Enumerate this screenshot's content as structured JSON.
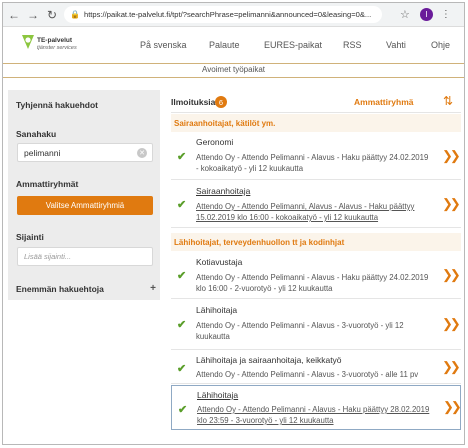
{
  "browser": {
    "back": "←",
    "forward": "→",
    "reload": "↻",
    "url": "https://paikat.te-palvelut.fi/tpt/?searchPhrase=pelimanni&announced=0&leasing=0&...",
    "avatar_letter": "I"
  },
  "header": {
    "logo_line1": "TE-palvelut",
    "logo_line2": "tjänster services",
    "nav": [
      "På svenska",
      "Palaute",
      "EURES-paikat",
      "RSS",
      "Vahti",
      "Ohje"
    ],
    "subtitle": "Avoimet työpaikat"
  },
  "sidebar": {
    "clear_label": "Tyhjennä hakuehdot",
    "keyword_label": "Sanahaku",
    "keyword_value": "pelimanni",
    "groups_label": "Ammattiryhmät",
    "groups_button": "Valitse Ammattiryhmiä",
    "location_label": "Sijainti",
    "location_placeholder": "Lisää sijainti...",
    "more_label": "Enemmän hakuehtoja",
    "more_icon": "+"
  },
  "results": {
    "title": "Ilmoituksia",
    "count": "6",
    "group_by": "Ammattiryhmä",
    "sort_icon": "⇅",
    "groups": [
      {
        "name": "Sairaanhoitajat, kätilöt ym.",
        "items": [
          {
            "title": "Geronomi",
            "desc": "Attendo Oy - Attendo Pelimanni - Alavus - Haku päättyy 24.02.2019 - kokoaikatyö - yli 12 kuukautta"
          },
          {
            "title": "Sairaanhoitaja",
            "desc": "Attendo Oy - Attendo Pelimanni, Alavus - Alavus - Haku päättyy 15.02.2019 klo 16:00 - kokoaikatyö - yli 12 kuukautta"
          }
        ]
      },
      {
        "name": "Lähihoitajat, terveydenhuollon tt ja kodinhjat",
        "items": [
          {
            "title": "Kotiavustaja",
            "desc": "Attendo Oy - Attendo Pelimanni - Alavus - Haku päättyy 24.02.2019 klo 16:00 - 2-vuorotyö - yli 12 kuukautta"
          },
          {
            "title": "Lähihoitaja",
            "desc": "Attendo Oy - Attendo Pelimanni - Alavus - 3-vuorotyö - yli 12 kuukautta"
          },
          {
            "title": "Lähihoitaja ja sairaanhoitaja, keikkatyö",
            "desc": "Attendo Oy - Attendo Pelimanni - Alavus - 3-vuorotyö - alle 11 pv"
          },
          {
            "title": "Lähihoitaja",
            "desc": "Attendo Oy - Attendo Pelimanni - Alavus - Haku päättyy 28.02.2019 klo 23:59 - 3-vuorotyö - yli 12 kuukautta"
          }
        ]
      }
    ],
    "check_icon": "✔",
    "chevron_icon": "❯❯"
  },
  "colors": {
    "accent_orange": "#e07a10",
    "check_green": "#5a9e2a",
    "sidebar_bg": "#ececec"
  }
}
